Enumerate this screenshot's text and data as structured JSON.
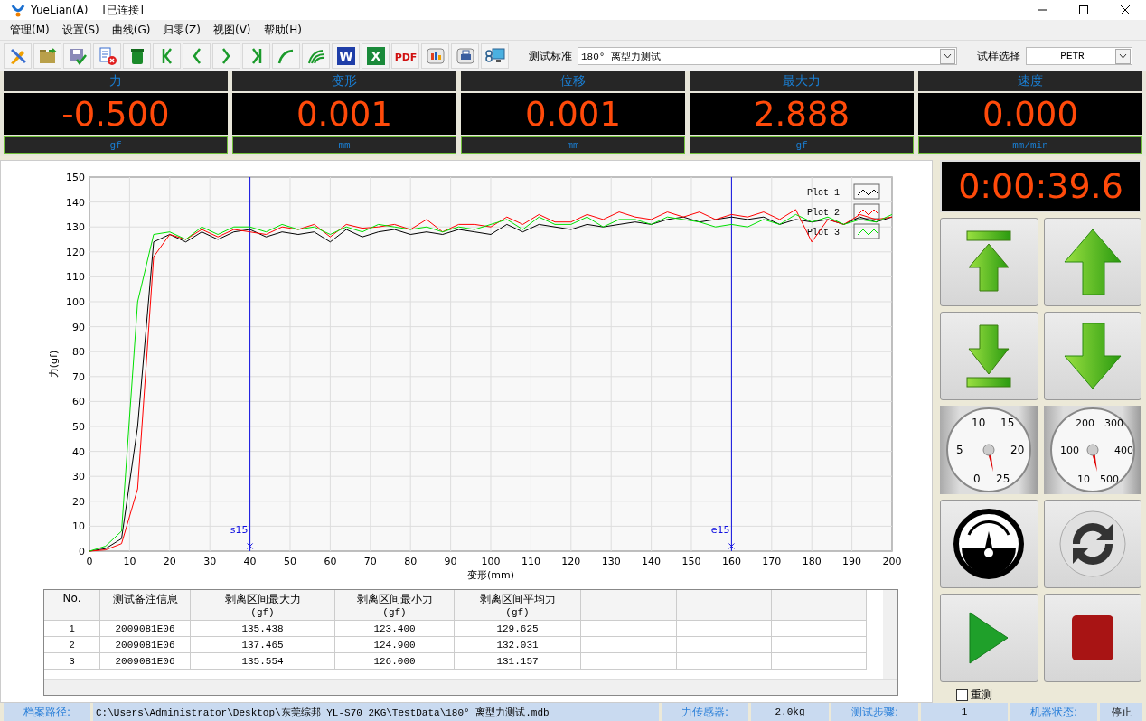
{
  "window": {
    "title": "YueLian(A)",
    "status": "[已连接]"
  },
  "menu": [
    "管理(M)",
    "设置(S)",
    "曲线(G)",
    "归零(Z)",
    "视图(V)",
    "帮助(H)"
  ],
  "toolbar": [
    {
      "kind": "tools"
    },
    {
      "kind": "open"
    },
    {
      "kind": "save"
    },
    {
      "kind": "delete-doc"
    },
    {
      "kind": "trash"
    },
    {
      "kind": "first"
    },
    {
      "kind": "prev"
    },
    {
      "kind": "next"
    },
    {
      "kind": "last"
    },
    {
      "kind": "curve"
    },
    {
      "kind": "curves"
    },
    {
      "kind": "word",
      "glyph": "W"
    },
    {
      "kind": "excel",
      "glyph": "X"
    },
    {
      "kind": "pdf",
      "glyph": "PDF"
    },
    {
      "kind": "report"
    },
    {
      "kind": "print"
    },
    {
      "kind": "monitor"
    }
  ],
  "standard": {
    "label": "测试标准",
    "value": "180°  离型力测试"
  },
  "sample": {
    "label": "试样选择",
    "value": "PETR"
  },
  "displays": [
    {
      "title": "力",
      "value": "-0.500",
      "unit": "gf"
    },
    {
      "title": "变形",
      "value": "0.001",
      "unit": "mm"
    },
    {
      "title": "位移",
      "value": "0.001",
      "unit": "mm"
    },
    {
      "title": "最大力",
      "value": "2.888",
      "unit": "gf"
    },
    {
      "title": "速度",
      "value": "0.000",
      "unit": "mm/min"
    }
  ],
  "chart_data": {
    "type": "line",
    "xlabel": "变形(mm)",
    "ylabel": "力(gf)",
    "xlim": [
      0,
      200
    ],
    "ylim": [
      0,
      150
    ],
    "xticks": [
      0,
      10,
      20,
      30,
      40,
      50,
      60,
      70,
      80,
      90,
      100,
      110,
      120,
      130,
      140,
      150,
      160,
      170,
      180,
      190,
      200
    ],
    "yticks": [
      0,
      10,
      20,
      30,
      40,
      50,
      60,
      70,
      80,
      90,
      100,
      110,
      120,
      130,
      140,
      150
    ],
    "x": [
      0,
      4,
      8,
      12,
      16,
      20,
      24,
      28,
      32,
      36,
      40,
      44,
      48,
      52,
      56,
      60,
      64,
      68,
      72,
      76,
      80,
      84,
      88,
      92,
      96,
      100,
      104,
      108,
      112,
      116,
      120,
      124,
      128,
      132,
      136,
      140,
      144,
      148,
      152,
      156,
      160,
      164,
      168,
      172,
      176,
      180,
      184,
      188,
      192,
      196,
      200
    ],
    "series": [
      {
        "name": "Plot 1",
        "color": "#000000",
        "values": [
          0,
          1,
          5,
          50,
          124,
          127,
          124,
          128,
          125,
          128,
          129,
          126,
          128,
          127,
          128,
          124,
          129,
          126,
          128,
          129,
          127,
          128,
          127,
          129,
          128,
          127,
          131,
          128,
          131,
          130,
          129,
          131,
          130,
          131,
          132,
          131,
          133,
          134,
          132,
          133,
          134,
          133,
          134,
          131,
          133,
          132,
          133,
          131,
          134,
          132,
          134
        ]
      },
      {
        "name": "Plot 2",
        "color": "#ff0000",
        "values": [
          0,
          0.5,
          3,
          25,
          118,
          127,
          125,
          129,
          126,
          129,
          128,
          127,
          130,
          129,
          131,
          126,
          131,
          129.5,
          130,
          131,
          129,
          133,
          128,
          131,
          131,
          130,
          134,
          131,
          135,
          132,
          132,
          135,
          133,
          136,
          134,
          133,
          136,
          134,
          136,
          133,
          135,
          134,
          136,
          133,
          137,
          124,
          133,
          131,
          135,
          133,
          134
        ]
      },
      {
        "name": "Plot 3",
        "color": "#00e000",
        "values": [
          0,
          2,
          8,
          100,
          127,
          128,
          125,
          130,
          127,
          130,
          130,
          128,
          131,
          129,
          130,
          127,
          130,
          128,
          131,
          130,
          129,
          130,
          128,
          130,
          129,
          131,
          133,
          129,
          134,
          131,
          131,
          134,
          130,
          133,
          133,
          131,
          134,
          133,
          132,
          130,
          131,
          130,
          133,
          131,
          135,
          132,
          134,
          131,
          133,
          132,
          135
        ]
      }
    ],
    "grid": true,
    "legend": "top-right",
    "annotations": [
      {
        "x": 40,
        "y": 2,
        "text": "s15"
      },
      {
        "x": 160,
        "y": 2,
        "text": "e15"
      }
    ]
  },
  "table": {
    "columns": [
      {
        "label": "No."
      },
      {
        "label": "测试备注信息"
      },
      {
        "label": "剥离区间最大力",
        "unit": "(gf)"
      },
      {
        "label": "剥离区间最小力",
        "unit": "(gf)"
      },
      {
        "label": "剥离区间平均力",
        "unit": "(gf)"
      }
    ],
    "rows": [
      [
        "1",
        "2009081E06",
        "135.438",
        "123.400",
        "129.625"
      ],
      [
        "2",
        "2009081E06",
        "137.465",
        "124.900",
        "132.031"
      ],
      [
        "3",
        "2009081E06",
        "135.554",
        "126.000",
        "131.157"
      ]
    ]
  },
  "timer": "0:00:39.6",
  "controls": [
    {
      "kind": "to-top"
    },
    {
      "kind": "up"
    },
    {
      "kind": "to-bottom"
    },
    {
      "kind": "down"
    },
    {
      "kind": "gauge",
      "labels": [
        "10",
        "15",
        "5",
        "20",
        "0",
        "25"
      ]
    },
    {
      "kind": "gauge",
      "labels": [
        "200",
        "300",
        "100",
        "400",
        "10",
        "500"
      ]
    },
    {
      "kind": "meter"
    },
    {
      "kind": "refresh"
    },
    {
      "kind": "play"
    },
    {
      "kind": "stop"
    }
  ],
  "retest": {
    "label": "重测",
    "checked": false
  },
  "status_bar": [
    {
      "label": "档案路径:",
      "value": "C:\\Users\\Administrator\\Desktop\\东莞综邦 YL-S70 2KG\\TestData\\180°  离型力测试.mdb"
    },
    {
      "label": "力传感器:",
      "value": "2.0kg"
    },
    {
      "label": "测试步骤:",
      "value": "1"
    },
    {
      "label": "机器状态:",
      "value": "停止"
    }
  ]
}
